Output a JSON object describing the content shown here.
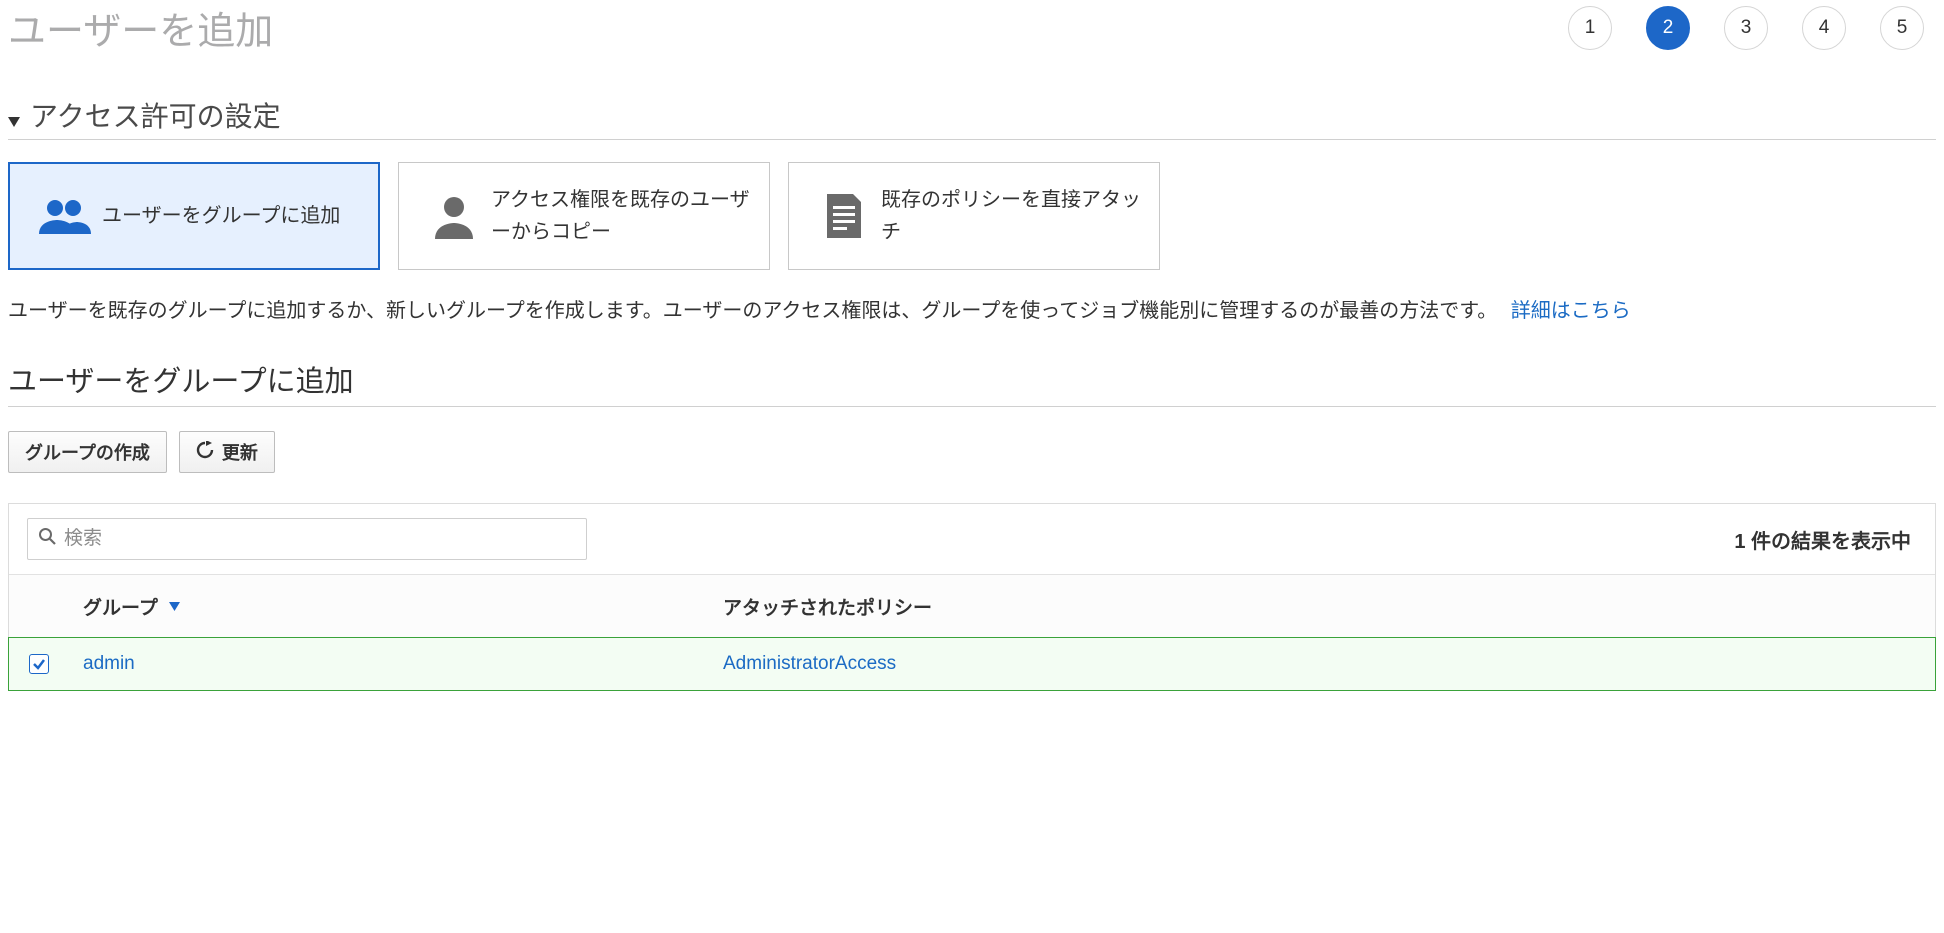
{
  "page_title": "ユーザーを追加",
  "steps": [
    "1",
    "2",
    "3",
    "4",
    "5"
  ],
  "active_step_index": 1,
  "section_title": "アクセス許可の設定",
  "options": [
    {
      "label": "ユーザーをグループに追加",
      "icon": "users-icon",
      "selected": true
    },
    {
      "label": "アクセス権限を既存のユーザーからコピー",
      "icon": "person-icon",
      "selected": false
    },
    {
      "label": "既存のポリシーを直接アタッチ",
      "icon": "document-icon",
      "selected": false
    }
  ],
  "description_text": "ユーザーを既存のグループに追加するか、新しいグループを作成します。ユーザーのアクセス権限は、グループを使ってジョブ機能別に管理するのが最善の方法です。",
  "description_link": "詳細はこちら",
  "sub_heading": "ユーザーをグループに追加",
  "toolbar": {
    "create_group": "グループの作成",
    "refresh": "更新"
  },
  "search_placeholder": "検索",
  "result_count": "1 件の結果を表示中",
  "columns": {
    "group": "グループ",
    "policy": "アタッチされたポリシー"
  },
  "rows": [
    {
      "checked": true,
      "group": "admin",
      "policy": "AdministratorAccess"
    }
  ]
}
